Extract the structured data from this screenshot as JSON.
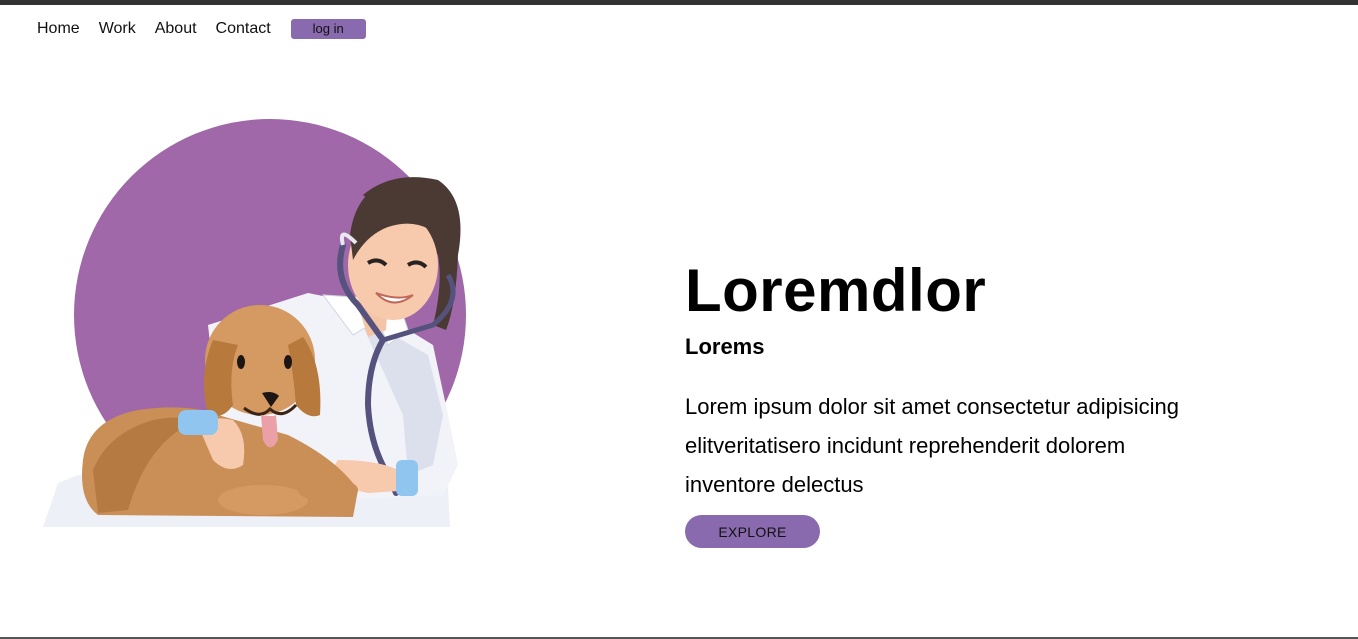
{
  "nav": {
    "items": [
      {
        "label": "Home"
      },
      {
        "label": "Work"
      },
      {
        "label": "About"
      },
      {
        "label": "Contact"
      }
    ],
    "login_label": "log in"
  },
  "hero": {
    "title": "Loremdlor",
    "subtitle": "Lorems",
    "body": "Lorem ipsum dolor sit amet consectetur adipisicing elitveritatisero incidunt reprehenderit dolorem inventore delectus",
    "cta_label": "EXPLORE"
  },
  "colors": {
    "accent": "#8a6aae",
    "circle": "#a068a8",
    "topbar": "#333333"
  },
  "illustration": {
    "icon": "vet-with-dog-illustration"
  }
}
